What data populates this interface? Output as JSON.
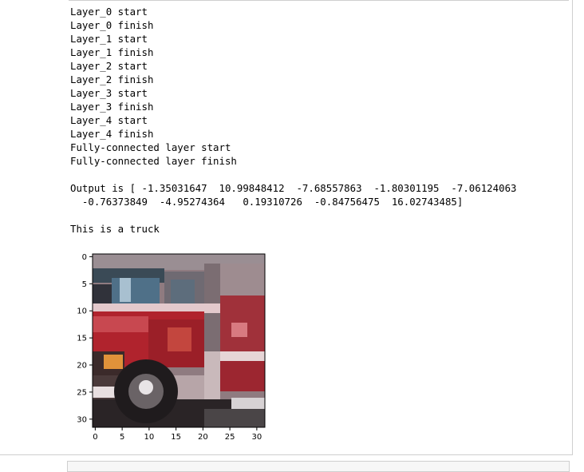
{
  "output": {
    "lines": [
      "Layer_0 start",
      "Layer_0 finish",
      "Layer_1 start",
      "Layer_1 finish",
      "Layer_2 start",
      "Layer_2 finish",
      "Layer_3 start",
      "Layer_3 finish",
      "Layer_4 start",
      "Layer_4 finish",
      "Fully-connected layer start",
      "Fully-connected layer finish",
      "",
      "Output is [ -1.35031647  10.99848412  -7.68557863  -1.80301195  -7.06124063",
      "  -0.76373849  -4.95274364   0.19310726  -0.84756475  16.02743485]",
      "",
      "This is a truck"
    ]
  },
  "image_plot": {
    "y_ticks": [
      "0",
      "5",
      "10",
      "15",
      "20",
      "25",
      "30"
    ],
    "x_ticks": [
      "0",
      "5",
      "10",
      "15",
      "20",
      "25",
      "30"
    ],
    "y_tick_values": [
      0,
      5,
      10,
      15,
      20,
      25,
      30
    ],
    "x_tick_values": [
      0,
      5,
      10,
      15,
      20,
      25,
      30
    ],
    "pixel_extent": [
      32,
      32
    ]
  }
}
